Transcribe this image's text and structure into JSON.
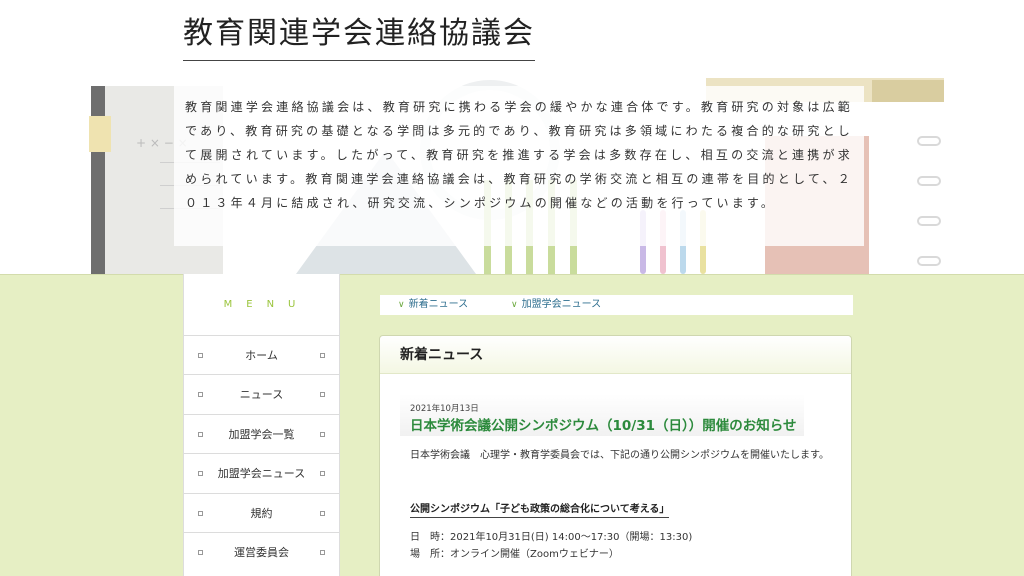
{
  "header": {
    "site_title": "教育関連学会連絡協議会",
    "description": "教育関連学会連絡協議会は、教育研究に携わる学会の緩やかな連合体です。教育研究の対象は広範であり、教育研究の基礎となる学問は多元的であり、教育研究は多領域にわたる複合的な研究として展開されています。したがって、教育研究を推進する学会は多数存在し、相互の交流と連携が求められています。教育関連学会連絡協議会は、教育研究の学術交流と相互の連帯を目的として、２０１３年４月に結成され、研究交流、シンポジウムの開催などの活動を行っています。",
    "deco_text": "+ × − ×"
  },
  "sidebar": {
    "menu_title": "MENU",
    "items": [
      {
        "label": "ホーム"
      },
      {
        "label": "ニュース"
      },
      {
        "label": "加盟学会一覧"
      },
      {
        "label": "加盟学会ニュース"
      },
      {
        "label": "規約"
      },
      {
        "label": "運営委員会"
      }
    ]
  },
  "tabs": [
    {
      "label": "新着ニュース"
    },
    {
      "label": "加盟学会ニュース"
    }
  ],
  "panel": {
    "heading": "新着ニュース",
    "article": {
      "date": "2021年10月13日",
      "title": "日本学術会議公開シンポジウム（10/31（日））開催のお知らせ",
      "body": "日本学術会議　心理学・教育学委員会では、下記の通り公開シンポジウムを開催いたします。",
      "subtitle": "公開シンポジウム「子ども政策の総合化について考える」",
      "datetime": "日　時：2021年10月31日(日) 14:00～17:30（開場：13:30)",
      "venue": "場　所：オンライン開催（Zoomウェビナー）"
    }
  },
  "colors": {
    "background": "#e6efc4",
    "accent_green": "#9ac43b",
    "title_green": "#2c8a3c",
    "tab_link": "#2f6f8f"
  }
}
